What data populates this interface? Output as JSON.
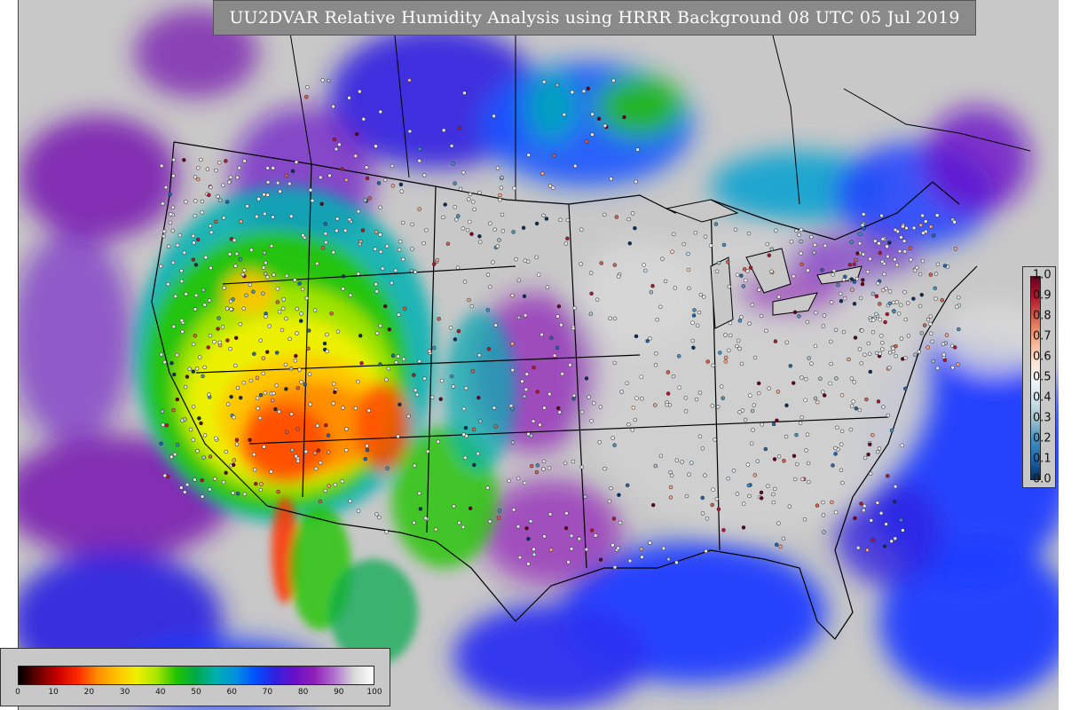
{
  "title": "UU2DVAR Relative Humidity Analysis using HRRR Background 08 UTC 05 Jul 2019",
  "rh_colorbar": {
    "ticks": [
      "0",
      "10",
      "20",
      "30",
      "40",
      "50",
      "60",
      "70",
      "80",
      "90",
      "100"
    ],
    "tick_values": [
      0,
      10,
      20,
      30,
      40,
      50,
      60,
      70,
      80,
      90,
      100
    ],
    "colors": [
      "#000000",
      "#6b0000",
      "#cc0000",
      "#ff2a00",
      "#ff8c00",
      "#ffc400",
      "#f0f000",
      "#a8e600",
      "#22c400",
      "#00a84a",
      "#00b0b0",
      "#0090e0",
      "#0050ff",
      "#3020e0",
      "#6a10c8",
      "#9020b8",
      "#b070d0",
      "#d8d8d8",
      "#ffffff"
    ]
  },
  "increment_colorbar": {
    "ticks": [
      "1.0",
      "0.9",
      "0.8",
      "0.7",
      "0.6",
      "0.5",
      "0.4",
      "0.3",
      "0.2",
      "0.1",
      "0.0"
    ],
    "tick_values": [
      1.0,
      0.9,
      0.8,
      0.7,
      0.6,
      0.5,
      0.4,
      0.3,
      0.2,
      0.1,
      0.0
    ],
    "colors": [
      "#67001f",
      "#b2182b",
      "#d6604d",
      "#f4a582",
      "#fddbc7",
      "#f7f7f7",
      "#d1e5f0",
      "#a8c4cc",
      "#4393c3",
      "#2166ac",
      "#053061"
    ]
  },
  "map_colors": {
    "background": "#c8c8c8",
    "ocean_purple": "#7a1fb0",
    "ocean_blue": "#1e3cff",
    "land_gray": "#cfcfcf",
    "dry_red": "#ff3300",
    "dry_orange": "#ff9900",
    "mid_yellow": "#f2e600",
    "mid_green": "#33cc00",
    "cyan": "#00c0c0",
    "border_black": "#000000"
  }
}
